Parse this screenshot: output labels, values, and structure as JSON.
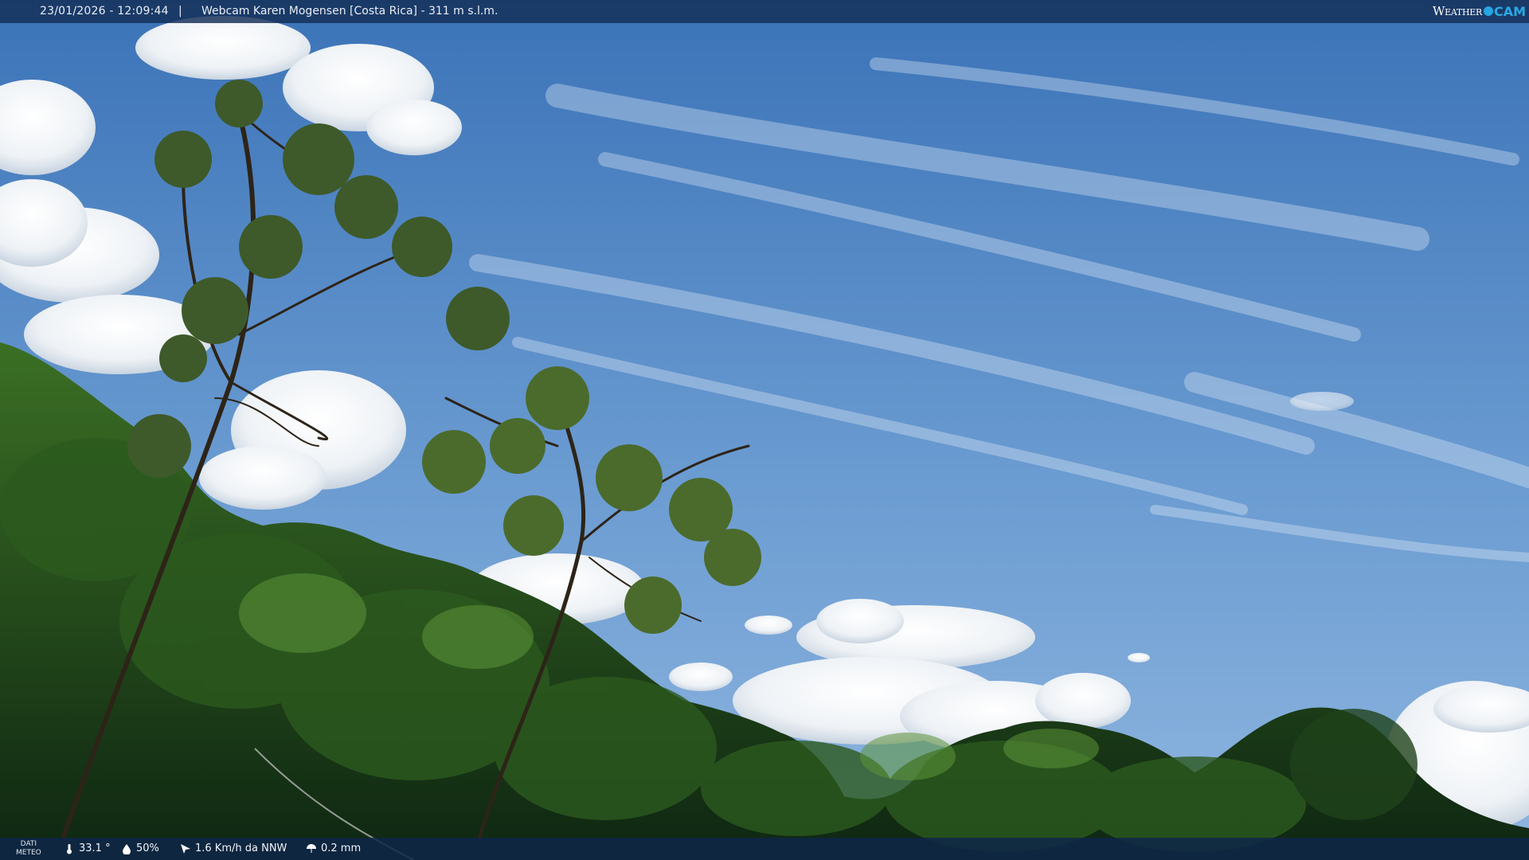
{
  "header": {
    "timestamp": "23/01/2026 - 12:09:44",
    "separator": "|",
    "title": "Webcam Karen Mogensen [Costa Rica] - 311 m s.l.m.",
    "logo_weather": "Weather",
    "logo_cam": "CAM"
  },
  "footer": {
    "label_line1": "DATI",
    "label_line2": "METEO",
    "temperature": "33.1 °",
    "humidity": "50%",
    "wind": "1.6 Km/h da NNW",
    "rain": "0.2 mm"
  },
  "colors": {
    "sky_top": "#3f78bd",
    "sky_mid": "#6e9fd3",
    "foliage_dark": "#15331a",
    "foliage_light": "#4f8a2e",
    "bar": "#122d55",
    "logo_accent": "#26a6e0"
  }
}
